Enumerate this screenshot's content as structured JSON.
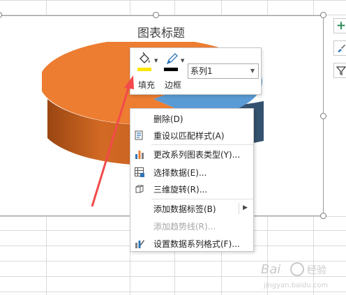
{
  "chart": {
    "title": "图表标题",
    "colors": {
      "orange": "#ED7D31",
      "orange_dark": "#B9541A",
      "blue": "#5B9BD5",
      "blue_dark": "#2E4D6B"
    }
  },
  "mini_toolbar": {
    "fill_label": "填充",
    "border_label": "边框",
    "series_value": "系列1",
    "fill_color": "#FFE600",
    "border_color": "#000000"
  },
  "context_menu": {
    "items": [
      {
        "label": "删除(D)",
        "icon": "",
        "enabled": true
      },
      {
        "label": "重设以匹配样式(A)",
        "icon": "reset-style-icon",
        "enabled": true
      },
      {
        "label": "更改系列图表类型(Y)...",
        "icon": "bar-chart-icon",
        "enabled": true
      },
      {
        "label": "选择数据(E)...",
        "icon": "select-data-icon",
        "enabled": true
      },
      {
        "label": "三维旋转(R)...",
        "icon": "3d-rotation-icon",
        "enabled": true
      },
      {
        "label": "添加数据标签(B)",
        "icon": "",
        "enabled": true,
        "submenu": true
      },
      {
        "label": "添加趋势线(R)...",
        "icon": "",
        "enabled": false
      },
      {
        "label": "设置数据系列格式(F)...",
        "icon": "format-series-icon",
        "enabled": true
      }
    ]
  },
  "annotation": {
    "arrow_color": "#F24A4A"
  }
}
